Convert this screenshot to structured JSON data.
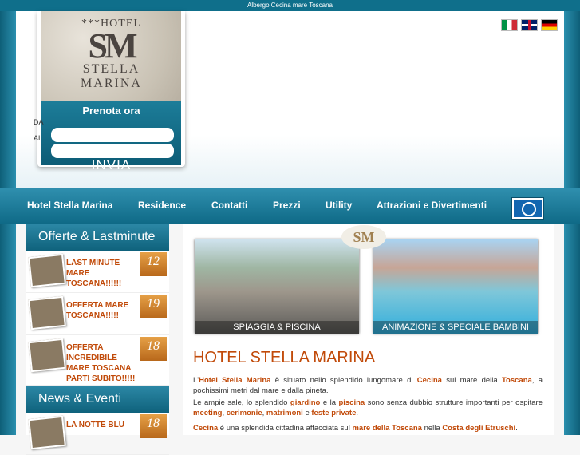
{
  "topbar": {
    "title": "Albergo Cecina mare Toscana"
  },
  "flags": [
    "italian-flag",
    "english-flag",
    "german-flag"
  ],
  "logo": {
    "small": "***HOTEL",
    "monogram": "SM",
    "name_line1": "STELLA",
    "name_line2": "MARINA"
  },
  "booking": {
    "title": "Prenota ora",
    "from_label": "DA",
    "to_label": "AL",
    "send_label": "INVIA"
  },
  "nav": {
    "items": [
      "Hotel Stella Marina",
      "Residence",
      "Contatti",
      "Prezzi",
      "Utility",
      "Attrazioni e Divertimenti"
    ]
  },
  "offers": {
    "header": "Offerte & Lastminute",
    "items": [
      {
        "title": "LAST MINUTE MARE TOSCANA!!!!!!",
        "day": "12"
      },
      {
        "title": "OFFERTA MARE TOSCANA!!!!!",
        "day": "19"
      },
      {
        "title": "OFFERTA INCREDIBILE MARE TOSCANA PARTI SUBITO!!!!!",
        "day": "18"
      }
    ]
  },
  "news": {
    "header": "News & Eventi",
    "items": [
      {
        "title": "LA NOTTE BLU",
        "day": "18"
      }
    ]
  },
  "main": {
    "logo": "SM",
    "photo1_caption": "SPIAGGIA & PISCINA",
    "photo2_caption": "ANIMAZIONE & SPECIALE BAMBINI",
    "title": "HOTEL STELLA MARINA",
    "p1": {
      "a": "L'",
      "b": "Hotel Stella Marina",
      "c": " è situato nello splendido lungomare di ",
      "d": "Cecina",
      "e": " sul mare della ",
      "f": "Toscana",
      "g": ", a pochissimi metri dal mare e dalla pineta."
    },
    "p2": {
      "a": "Le ampie sale, lo splendido ",
      "b": "giardino",
      "c": " e la ",
      "d": "piscina",
      "e": " sono senza dubbio strutture importanti per ospitare ",
      "f": "meeting",
      "g": ", ",
      "h": "cerimonie",
      "i": ", ",
      "j": "matrimoni",
      "k": " e ",
      "l": "feste private",
      "m": "."
    },
    "p3": {
      "a": "Cecina",
      "b": " è una splendida cittadina affacciata sul ",
      "c": "mare della Toscana",
      "d": " nella ",
      "e": "Costa degli Etruschi",
      "f": "."
    }
  },
  "colors": {
    "accent": "#c14a09",
    "teal": "#0f6a87"
  }
}
